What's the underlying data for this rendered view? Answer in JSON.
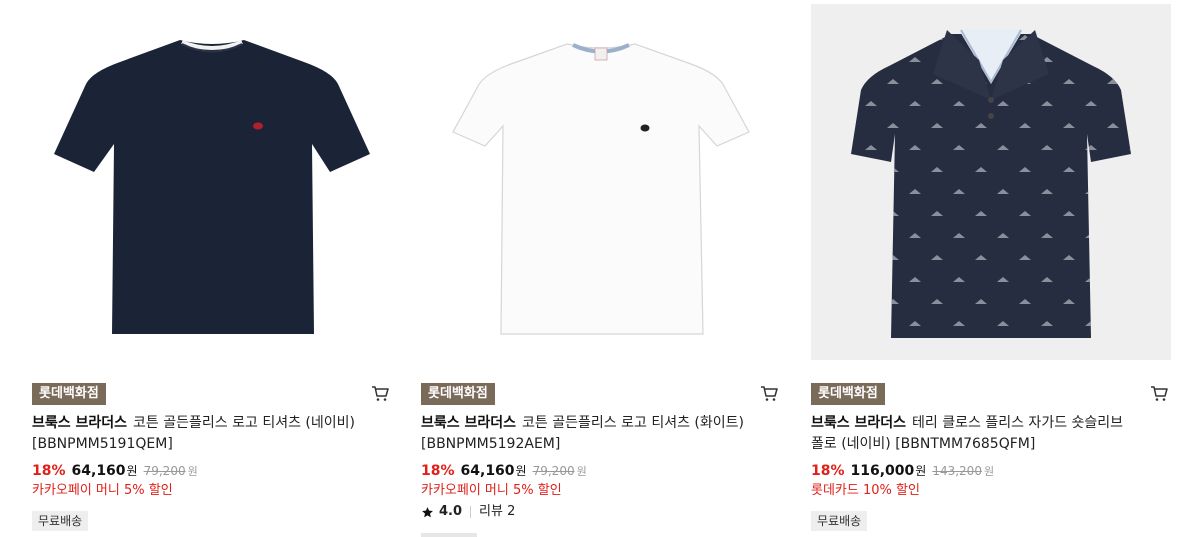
{
  "products": [
    {
      "store": "롯데백화점",
      "brand": "브룩스 브라더스",
      "name_line1": "코튼 골든플리스 로고 티셔츠 (네이비)",
      "name_line2": "[BBNPMM5191QEM]",
      "discount": "18%",
      "price": "64,160",
      "currency": "원",
      "original_price": "79,200",
      "promo": "카카오페이 머니 5% 할인",
      "free_shipping": "무료배송",
      "image_icon": "navy-tshirt-image",
      "color": "#1b2436"
    },
    {
      "store": "롯데백화점",
      "brand": "브룩스 브라더스",
      "name_line1": "코튼 골든플리스 로고 티셔츠 (화이트)",
      "name_line2": "[BBNPMM5192AEM]",
      "discount": "18%",
      "price": "64,160",
      "currency": "원",
      "original_price": "79,200",
      "promo": "카카오페이 머니 5% 할인",
      "rating": "4.0",
      "review_label": "리뷰 2",
      "image_icon": "white-tshirt-image",
      "color": "#ffffff"
    },
    {
      "store": "롯데백화점",
      "brand": "브룩스 브라더스",
      "name_line1": "테리 클로스 플리스 자가드 숏슬리브",
      "name_line2": "폴로 (네이비) [BBNTMM7685QFM]",
      "discount": "18%",
      "price": "116,000",
      "currency": "원",
      "original_price": "143,200",
      "promo": "롯데카드 10% 할인",
      "free_shipping": "무료배송",
      "image_icon": "navy-polo-image",
      "color": "#262d40"
    }
  ],
  "colors": {
    "discount_red": "#e0201a",
    "store_badge_bg": "#7a6a5a"
  }
}
